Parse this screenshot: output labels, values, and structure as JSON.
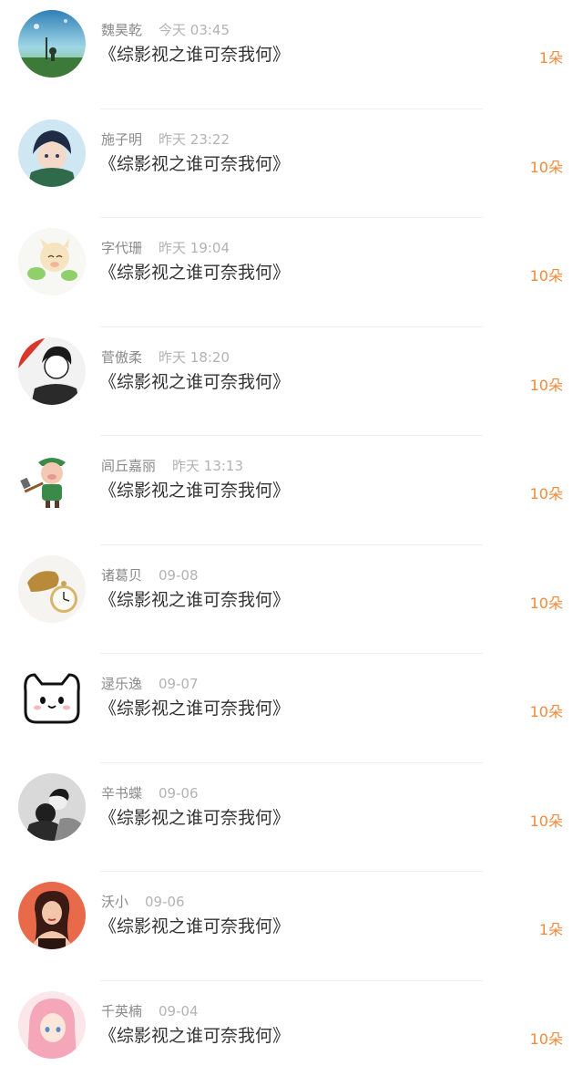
{
  "items": [
    {
      "name": "魏昊乾",
      "time": "今天 03:45",
      "title": "《综影视之谁可奈我何》",
      "gift": "1朵",
      "avatar_icon": "landscape-avatar-icon"
    },
    {
      "name": "施子明",
      "time": "昨天 23:22",
      "title": "《综影视之谁可奈我何》",
      "gift": "10朵",
      "avatar_icon": "anime-boy-avatar-icon"
    },
    {
      "name": "字代珊",
      "time": "昨天 19:04",
      "title": "《综影视之谁可奈我何》",
      "gift": "10朵",
      "avatar_icon": "cartoon-pig-leaves-avatar-icon"
    },
    {
      "name": "菅傲柔",
      "time": "昨天 18:20",
      "title": "《综影视之谁可奈我何》",
      "gift": "10朵",
      "avatar_icon": "manga-boy-avatar-icon"
    },
    {
      "name": "闾丘嘉丽",
      "time": "昨天 13:13",
      "title": "《综影视之谁可奈我何》",
      "gift": "10朵",
      "avatar_icon": "pig-with-hammer-avatar-icon"
    },
    {
      "name": "诸葛贝",
      "time": "09-08",
      "title": "《综影视之谁可奈我何》",
      "gift": "10朵",
      "avatar_icon": "pocket-watch-avatar-icon"
    },
    {
      "name": "逯乐逸",
      "time": "09-07",
      "title": "《综影视之谁可奈我何》",
      "gift": "10朵",
      "avatar_icon": "cute-cat-avatar-icon"
    },
    {
      "name": "辛书蝶",
      "time": "09-06",
      "title": "《综影视之谁可奈我何》",
      "gift": "10朵",
      "avatar_icon": "bw-couple-avatar-icon"
    },
    {
      "name": "沃小",
      "time": "09-06",
      "title": "《综影视之谁可奈我何》",
      "gift": "1朵",
      "avatar_icon": "girl-portrait-avatar-icon"
    },
    {
      "name": "千英楠",
      "time": "09-04",
      "title": "《综影视之谁可奈我何》",
      "gift": "10朵",
      "avatar_icon": "pink-hair-girl-avatar-icon"
    }
  ],
  "colors": {
    "name": "#8a8a8a",
    "time": "#b3b3b3",
    "title": "#333333",
    "gift": "#f08a3c",
    "divider": "#eeeeee"
  }
}
